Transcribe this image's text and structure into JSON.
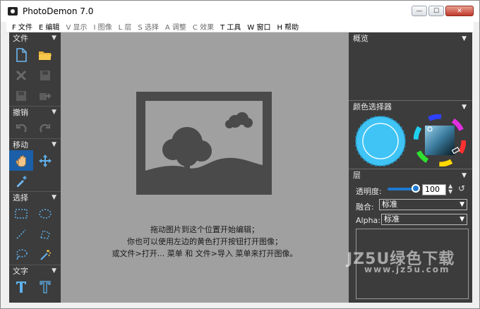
{
  "window": {
    "title": "PhotoDemon 7.0"
  },
  "menu": [
    {
      "label": "F 文件",
      "state": "active"
    },
    {
      "label": "E 编辑",
      "state": "active"
    },
    {
      "label": "V 显示",
      "state": "dim"
    },
    {
      "label": "I 图像",
      "state": "dim"
    },
    {
      "label": "L 层",
      "state": "dim"
    },
    {
      "label": "S 选择",
      "state": "dim"
    },
    {
      "label": "A 调整",
      "state": "dim"
    },
    {
      "label": "C 效果",
      "state": "dim"
    },
    {
      "label": "T 工具",
      "state": "active"
    },
    {
      "label": "W 窗口",
      "state": "active"
    },
    {
      "label": "H 帮助",
      "state": "active"
    }
  ],
  "left_panel": {
    "file_label": "文件",
    "undo_label": "撤销",
    "move_label": "移动",
    "select_label": "选择",
    "text_label": "文字"
  },
  "canvas": {
    "hint_line1": "拖动图片到这个位置开始编辑；",
    "hint_line2": "你也可以使用左边的黄色打开按钮打开图像；",
    "hint_line3": "或文件>打开... 菜单 和 文件>导入 菜单来打开图像。"
  },
  "right_panel": {
    "overview_label": "概览",
    "color_selector_label": "颜色选择器",
    "layers_label": "层",
    "opacity_label": "透明度:",
    "opacity_value": "100",
    "opacity_fraction": 1.0,
    "blend_label": "融合:",
    "blend_value": "标准",
    "alpha_label": "Alpha:",
    "alpha_value": "标准",
    "primary_color": "#3fc4f5"
  },
  "watermark": {
    "line1": "JZ5U绿色下载",
    "line2": "www.jz5u.com"
  }
}
